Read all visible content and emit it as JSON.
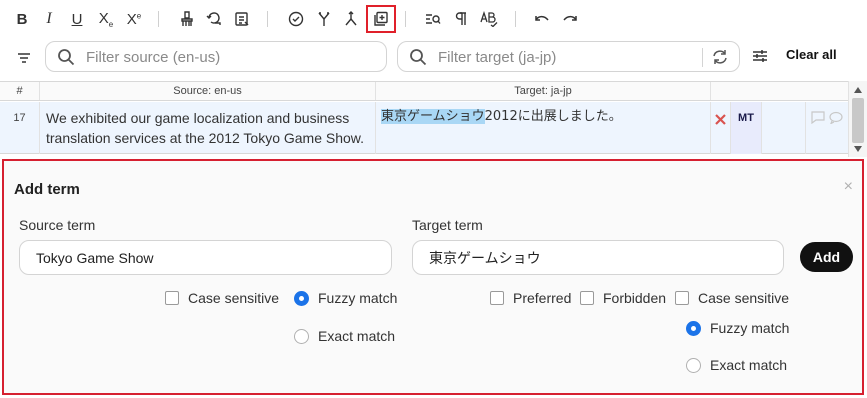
{
  "toolbar": {
    "bold": "B",
    "italic": "I",
    "underline": "U",
    "subscript": "X",
    "subscript_mark": "e",
    "superscript": "X",
    "superscript_mark": "e"
  },
  "filters": {
    "source_placeholder": "Filter source (en-us)",
    "target_placeholder": "Filter target (ja-jp)",
    "clear_all": "Clear all"
  },
  "grid": {
    "columns": [
      "#",
      "Source: en-us",
      "Target: ja-jp"
    ],
    "rows": [
      {
        "number": "17",
        "source": "We exhibited our game localization and business translation services at the 2012 Tokyo Game Show.",
        "target_highlight": "東京ゲームショウ",
        "target_rest": "2012に出展しました。",
        "badge": "MT"
      }
    ]
  },
  "add_term": {
    "title": "Add term",
    "close": "×",
    "source_label": "Source term",
    "target_label": "Target term",
    "source_value": "Tokyo Game Show",
    "target_value": "東京ゲームショウ",
    "add_button": "Add",
    "source_options": {
      "case_sensitive": "Case sensitive",
      "fuzzy_match": "Fuzzy match",
      "exact_match": "Exact match"
    },
    "target_options": {
      "preferred": "Preferred",
      "forbidden": "Forbidden",
      "case_sensitive": "Case sensitive",
      "fuzzy_match": "Fuzzy match",
      "exact_match": "Exact match"
    }
  },
  "colors": {
    "highlight_border": "#d62030",
    "radio_selected": "#1b73e8",
    "row_selected_bg": "#eef5fe",
    "target_highlight": "#a9d7f5",
    "error_x": "#d9534f"
  },
  "icons": [
    "bold-icon",
    "italic-icon",
    "underline-icon",
    "subscript-icon",
    "superscript-icon",
    "clear-format-icon",
    "copy-source-icon",
    "insert-tags-icon",
    "confirm-icon",
    "merge-icon",
    "split-icon",
    "add-term-icon",
    "find-icon",
    "pilcrow-icon",
    "spellcheck-icon",
    "undo-icon",
    "redo-icon",
    "filter-icon",
    "search-icon",
    "sync-icon",
    "sliders-icon",
    "delete-x-icon",
    "comment-icon"
  ]
}
